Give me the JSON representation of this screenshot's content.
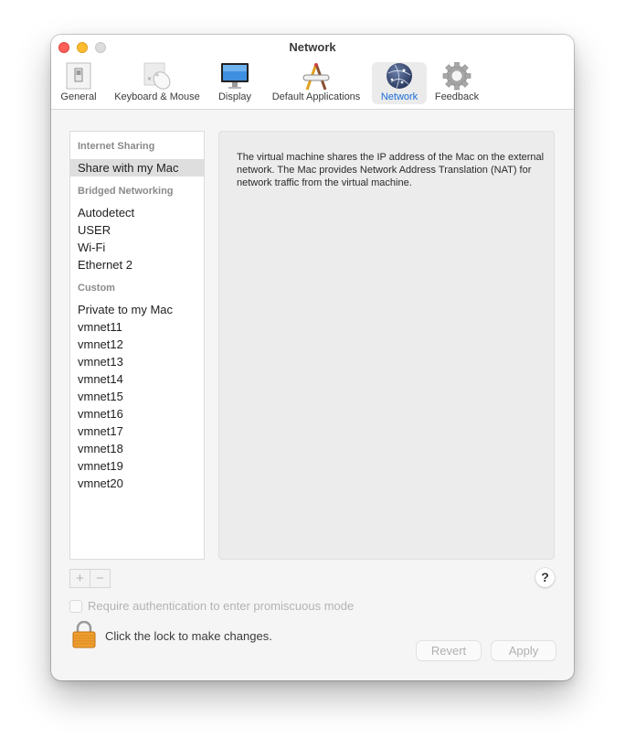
{
  "window": {
    "title": "Network"
  },
  "toolbar": {
    "items": [
      {
        "label": "General",
        "icon": "general-switch-icon",
        "active": false
      },
      {
        "label": "Keyboard & Mouse",
        "icon": "keyboard-mouse-icon",
        "active": false
      },
      {
        "label": "Display",
        "icon": "display-icon",
        "active": false
      },
      {
        "label": "Default Applications",
        "icon": "default-applications-icon",
        "active": false
      },
      {
        "label": "Network",
        "icon": "network-globe-icon",
        "active": true
      },
      {
        "label": "Feedback",
        "icon": "gear-icon",
        "active": false
      }
    ]
  },
  "sidebar": {
    "sections": [
      {
        "header": "Internet Sharing",
        "items": [
          "Share with my Mac"
        ]
      },
      {
        "header": "Bridged Networking",
        "items": [
          "Autodetect",
          "USER",
          "Wi-Fi",
          "Ethernet 2"
        ]
      },
      {
        "header": "Custom",
        "items": [
          "Private to my Mac",
          "vmnet11",
          "vmnet12",
          "vmnet13",
          "vmnet14",
          "vmnet15",
          "vmnet16",
          "vmnet17",
          "vmnet18",
          "vmnet19",
          "vmnet20"
        ]
      }
    ],
    "selected": "Share with my Mac"
  },
  "detail": {
    "description": "The virtual machine shares the IP address of the Mac on the external network. The Mac provides Network Address Translation (NAT) for network traffic from the virtual machine."
  },
  "controls": {
    "add_label": "+",
    "remove_label": "−",
    "help_label": "?",
    "promiscuous_label": "Require authentication to enter promiscuous mode",
    "promiscuous_checked": false,
    "lock_label": "Click the lock to make changes.",
    "revert_label": "Revert",
    "apply_label": "Apply"
  },
  "colors": {
    "accent": "#1a6cd8",
    "selected_row": "#dedede"
  }
}
